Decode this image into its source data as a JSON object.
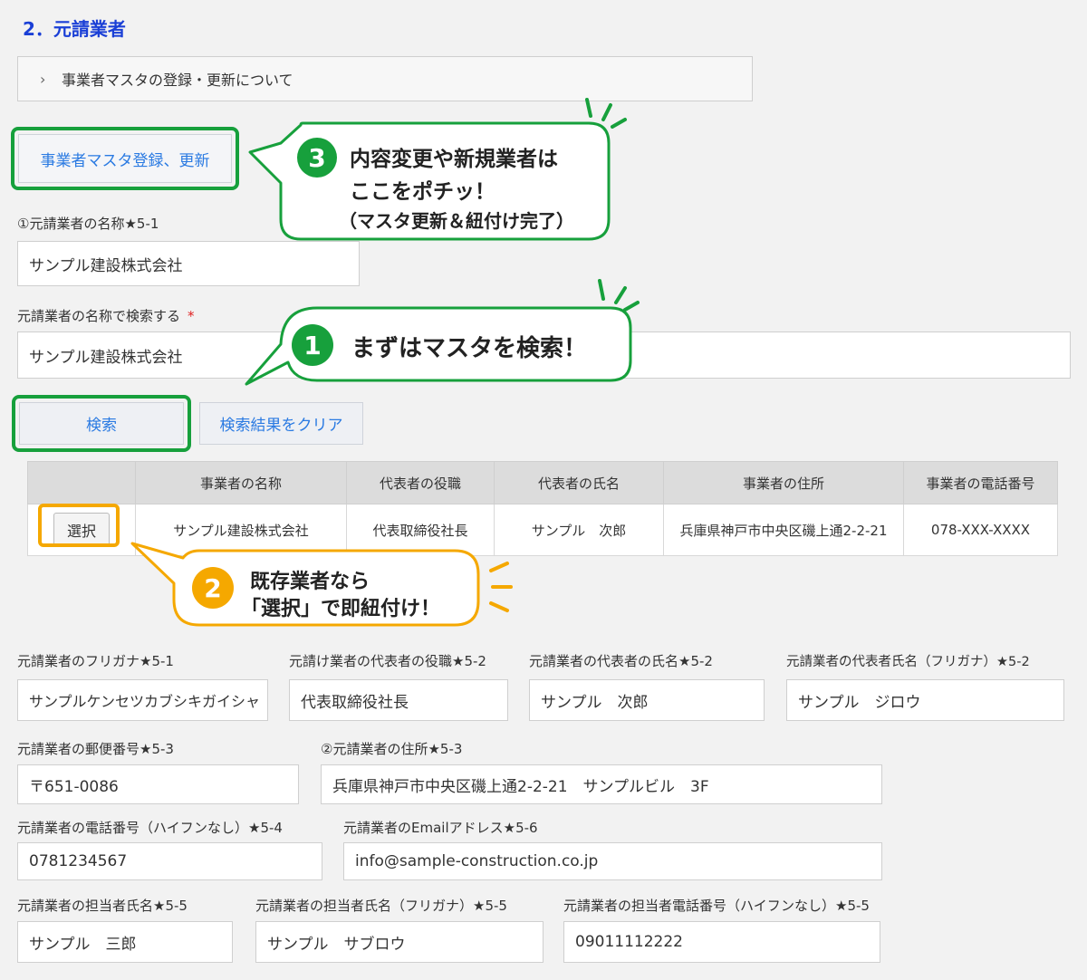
{
  "section": {
    "title": "2．元請業者"
  },
  "accordion": {
    "label": "事業者マスタの登録・更新について"
  },
  "buttons": {
    "master": "事業者マスタ登録、更新",
    "search": "検索",
    "clear": "検索結果をクリア",
    "select": "選択"
  },
  "name_field": {
    "label": "①元請業者の名称★5-1",
    "value": "サンプル建設株式会社"
  },
  "search_field": {
    "label": "元請業者の名称で検索する",
    "required": "*",
    "value": "サンプル建設株式会社"
  },
  "results": {
    "headers": [
      "",
      "事業者の名称",
      "代表者の役職",
      "代表者の氏名",
      "事業者の住所",
      "事業者の電話番号"
    ],
    "row": [
      "サンプル建設株式会社",
      "代表取締役社長",
      "サンプル　次郎",
      "兵庫県神戸市中央区磯上通2-2-21",
      "078-XXX-XXXX"
    ]
  },
  "callouts": {
    "c1": {
      "num": "1",
      "line1": "まずはマスタを検索！"
    },
    "c2": {
      "num": "2",
      "line1": "既存業者なら",
      "line2": "「選択」で即紐付け！"
    },
    "c3": {
      "num": "3",
      "line1": "内容変更や新規業者は",
      "line2": "ここをポチッ！",
      "line3": "（マスタ更新＆紐付け完了）"
    }
  },
  "fields": {
    "furigana": {
      "label": "元請業者のフリガナ★5-1",
      "value": "サンプルケンセツカブシキガイシャ"
    },
    "rep_title": {
      "label": "元請け業者の代表者の役職★5-2",
      "value": "代表取締役社長"
    },
    "rep_name": {
      "label": "元請業者の代表者の氏名★5-2",
      "value": "サンプル　次郎"
    },
    "rep_kana": {
      "label": "元請業者の代表者氏名（フリガナ）★5-2",
      "value": "サンプル　ジロウ"
    },
    "postal": {
      "label": "元請業者の郵便番号★5-3",
      "value": "〒651-0086"
    },
    "address": {
      "label": "②元請業者の住所★5-3",
      "value": "兵庫県神戸市中央区磯上通2-2-21　サンプルビル　3F"
    },
    "phone": {
      "label": "元請業者の電話番号（ハイフンなし）★5-4",
      "value": "0781234567"
    },
    "email": {
      "label": "元請業者のEmailアドレス★5-6",
      "value": "info@sample-construction.co.jp"
    },
    "contact": {
      "label": "元請業者の担当者氏名★5-5",
      "value": "サンプル　三郎"
    },
    "contact_kana": {
      "label": "元請業者の担当者氏名（フリガナ）★5-5",
      "value": "サンプル　サブロウ"
    },
    "contact_phone": {
      "label": "元請業者の担当者電話番号（ハイフンなし）★5-5",
      "value": "09011112222"
    }
  },
  "colors": {
    "accent_green": "#17a03c",
    "accent_orange": "#f5a800",
    "title_blue": "#1a3fd6",
    "link_blue": "#2a7ae2"
  }
}
